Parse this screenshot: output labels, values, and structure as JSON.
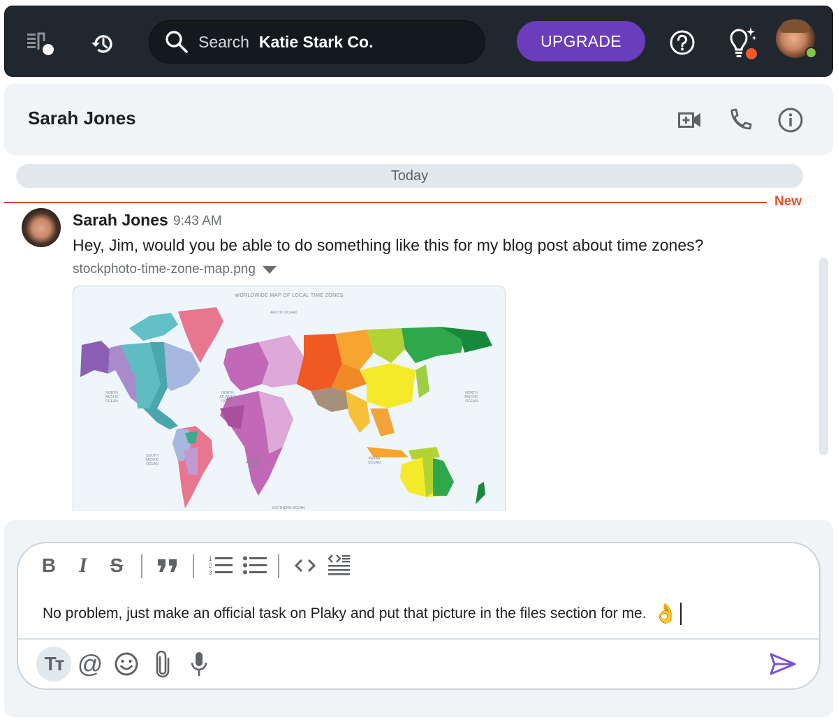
{
  "topbar": {
    "search_label": "Search",
    "workspace_name": "Katie Stark Co.",
    "upgrade_label": "UPGRADE",
    "icons": [
      "sidebar-toggle-icon",
      "history-icon",
      "search-icon",
      "help-icon",
      "whats-new-icon",
      "user-avatar"
    ],
    "colors": {
      "background": "#21272e",
      "upgrade": "#6b3cbc",
      "notification_dot": "#ef5a28",
      "online_dot": "#8bc34a"
    }
  },
  "chat_header": {
    "contact_name": "Sarah Jones",
    "actions": [
      "video-call-icon",
      "phone-call-icon",
      "info-icon"
    ]
  },
  "timeline": {
    "date_separator": "Today",
    "new_marker": "New",
    "new_color": "#ef4f27"
  },
  "message": {
    "author": "Sarah Jones",
    "time": "9:43 AM",
    "text": "Hey, Jim, would you be able to do something like this for my blog post about time zones?",
    "attachment": {
      "file_name": "stockphoto-time-zone-map.png",
      "image_title": "WORLDWIDE MAP OF LOCAL TIME ZONES",
      "ocean_labels": {
        "arctic": "ARCTIC OCEAN",
        "north_pacific_left": "NORTH PACIFIC OCEAN",
        "north_atlantic": "NORTH ATLANTIC OCEAN",
        "north_pacific_right": "NORTH PACIFIC OCEAN",
        "south_pacific": "SOUTH PACIFIC OCEAN",
        "south_atlantic": "SOUTH ATLANTIC OCEAN",
        "indian": "INDIAN OCEAN",
        "southern": "SOUTHERN OCEAN"
      }
    }
  },
  "composer": {
    "formatting": [
      "bold",
      "italic",
      "strikethrough",
      "quote",
      "ordered-list",
      "bulleted-list",
      "code",
      "code-block"
    ],
    "bold_glyph": "B",
    "italic_glyph": "I",
    "strike_glyph": "S",
    "text": "No problem, just make an official task on Plaky and put that picture in the files section for me.",
    "emoji": "👌",
    "actions": [
      "text-format",
      "mention",
      "emoji",
      "attach",
      "voice"
    ],
    "text_format_glyph": "Tт",
    "mention_glyph": "@",
    "send_color": "#7b4fd6"
  }
}
